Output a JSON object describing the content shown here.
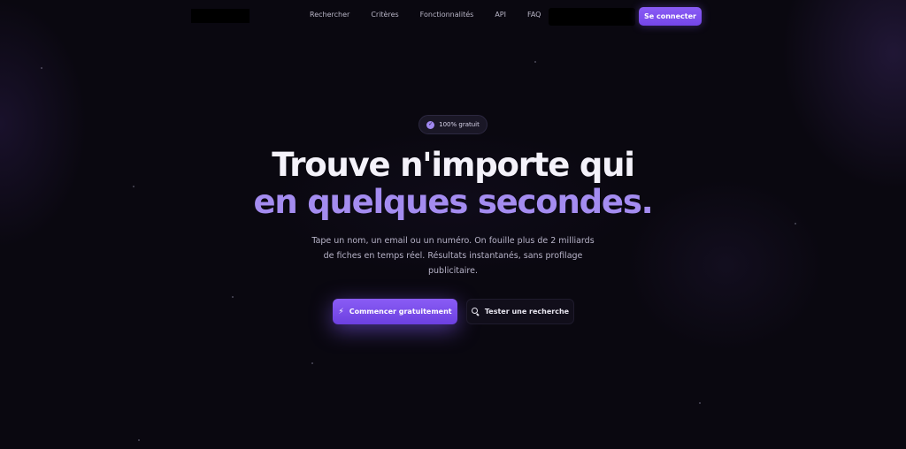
{
  "nav": {
    "links": [
      {
        "label": "Rechercher"
      },
      {
        "label": "Critères"
      },
      {
        "label": "Fonctionnalités"
      },
      {
        "label": "API"
      },
      {
        "label": "FAQ"
      }
    ],
    "login_label": "Se connecter"
  },
  "hero": {
    "badge": "100% gratuit",
    "headline_line1": "Trouve n'importe qui",
    "headline_line2": "en quelques secondes.",
    "description_line1": "Tape un nom, un email ou un numéro. On fouille plus de 2 milliards",
    "description_line2": "de fiches en temps réel. Résultats instantanés, sans profilage",
    "description_line3": "publicitaire.",
    "primary_cta": "Commencer gratuitement",
    "secondary_cta": "Tester une recherche"
  },
  "colors": {
    "accent": "#8a5cf5",
    "headline_accent": "#a48cf0",
    "background": "#0a0810"
  },
  "icons": {
    "badge": "check-circle-icon",
    "primary_cta": "lightning-icon",
    "secondary_cta": "search-icon"
  }
}
